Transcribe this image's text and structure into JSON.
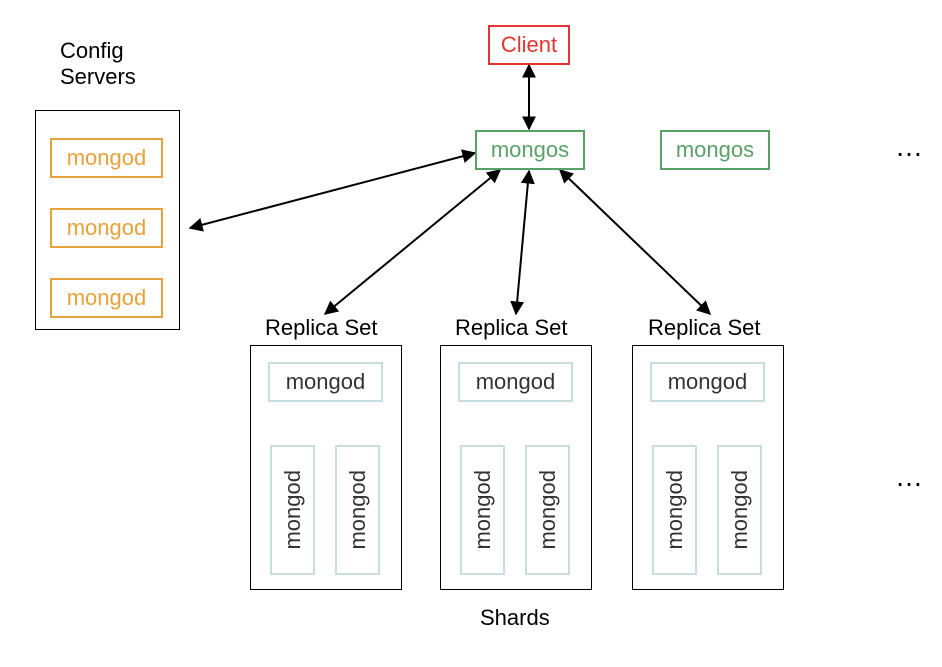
{
  "diagram": {
    "title_config": "Config\nServers",
    "title_shards": "Shards",
    "labels": {
      "client": "Client",
      "mongos1": "mongos",
      "mongos2": "mongos",
      "ellipsis1": "…",
      "ellipsis2": "…",
      "replica_set": "Replica Set",
      "mongod": "mongod"
    },
    "config_servers": [
      "mongod",
      "mongod",
      "mongod"
    ],
    "shards": [
      {
        "primary": "mongod",
        "secondaries": [
          "mongod",
          "mongod"
        ]
      },
      {
        "primary": "mongod",
        "secondaries": [
          "mongod",
          "mongod"
        ]
      },
      {
        "primary": "mongod",
        "secondaries": [
          "mongod",
          "mongod"
        ]
      }
    ],
    "colors": {
      "client": "#e53531",
      "mongos": "#5aa067",
      "config_mongod": "#e8a23a",
      "shard_mongod": "#c8dde0",
      "container": "#000000"
    },
    "architecture": "MongoDB sharded cluster: Client connects to mongos router(s). mongos communicates with Config Servers (replica set of 3 mongod) and with each Shard (each shard is a Replica Set of mongod instances)."
  }
}
